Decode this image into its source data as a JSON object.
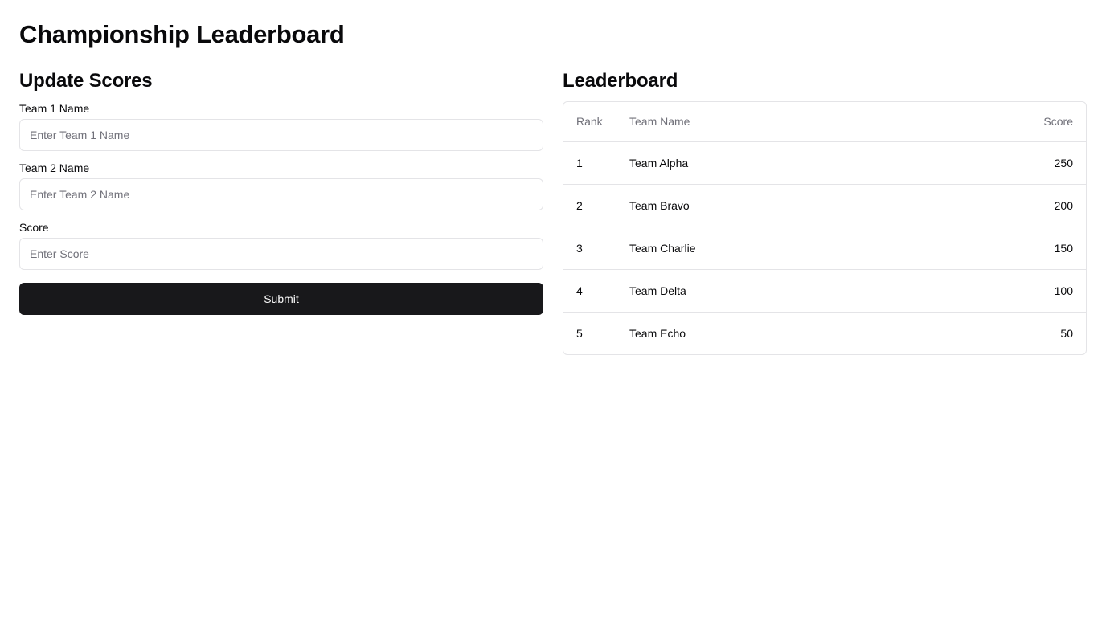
{
  "page": {
    "title": "Championship Leaderboard"
  },
  "form": {
    "heading": "Update Scores",
    "team1": {
      "label": "Team 1 Name",
      "placeholder": "Enter Team 1 Name",
      "value": ""
    },
    "team2": {
      "label": "Team 2 Name",
      "placeholder": "Enter Team 2 Name",
      "value": ""
    },
    "score": {
      "label": "Score",
      "placeholder": "Enter Score",
      "value": ""
    },
    "submit_label": "Submit"
  },
  "leaderboard": {
    "heading": "Leaderboard",
    "columns": {
      "rank": "Rank",
      "name": "Team Name",
      "score": "Score"
    },
    "rows": [
      {
        "rank": "1",
        "name": "Team Alpha",
        "score": "250"
      },
      {
        "rank": "2",
        "name": "Team Bravo",
        "score": "200"
      },
      {
        "rank": "3",
        "name": "Team Charlie",
        "score": "150"
      },
      {
        "rank": "4",
        "name": "Team Delta",
        "score": "100"
      },
      {
        "rank": "5",
        "name": "Team Echo",
        "score": "50"
      }
    ]
  },
  "colors": {
    "primary": "#18181b",
    "border": "#e4e4e7",
    "muted_text": "#71717a"
  }
}
